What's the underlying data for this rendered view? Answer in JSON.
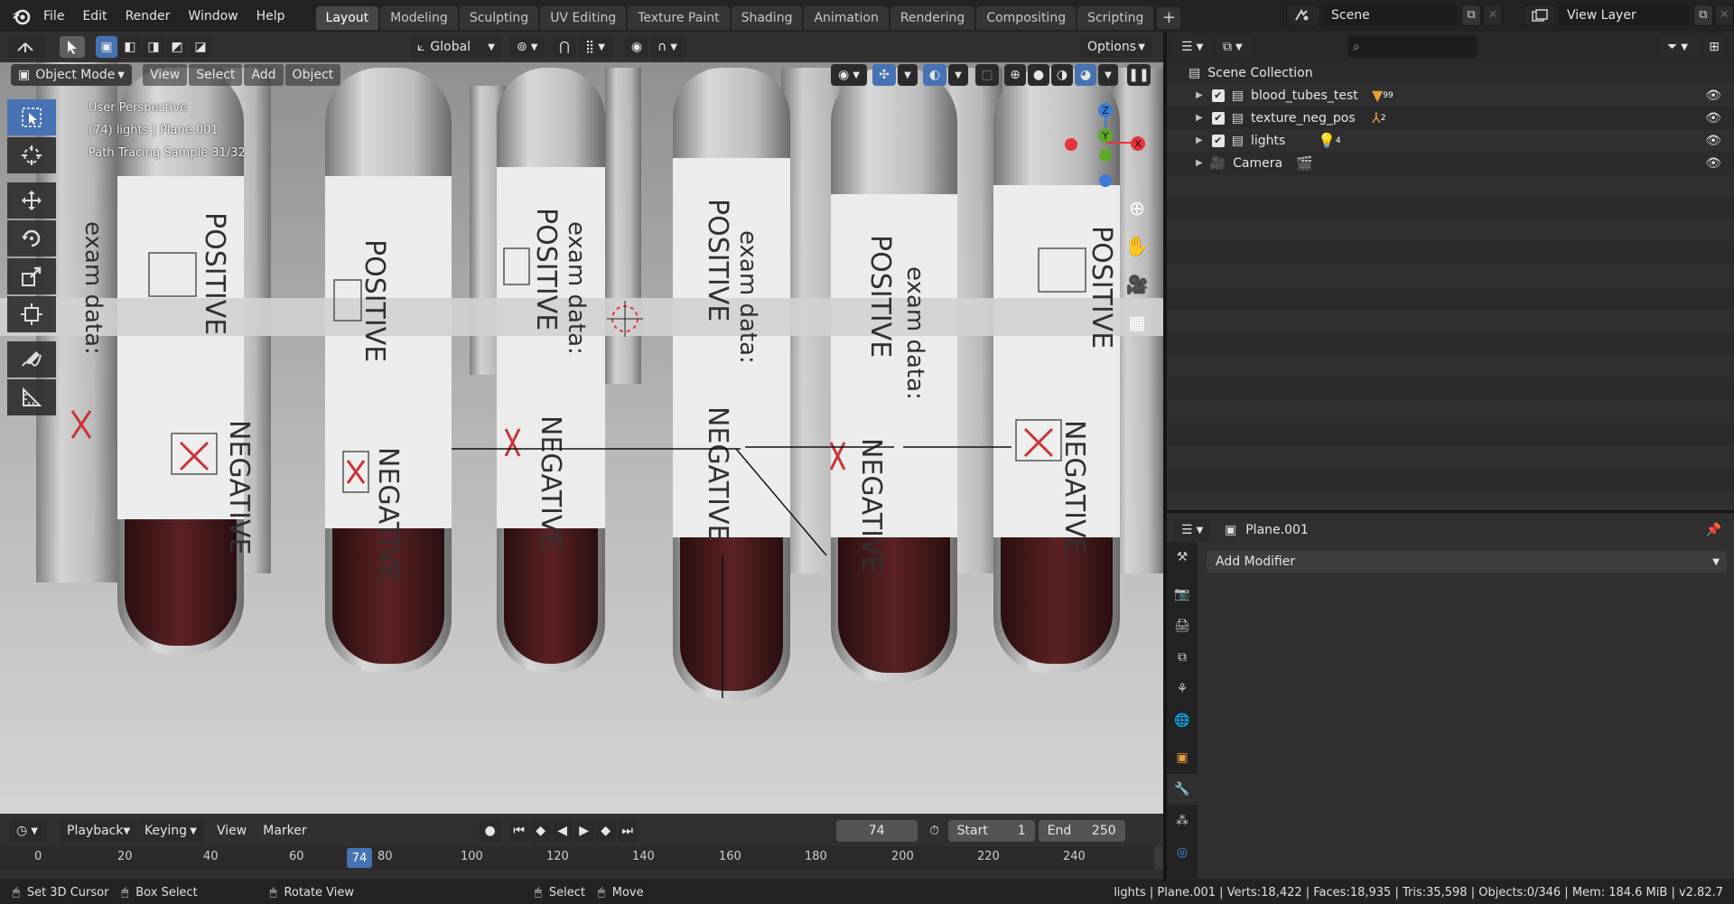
{
  "menu": {
    "items": [
      "File",
      "Edit",
      "Render",
      "Window",
      "Help"
    ]
  },
  "workspaces": [
    {
      "label": "Layout",
      "active": true
    },
    {
      "label": "Modeling",
      "active": false
    },
    {
      "label": "Sculpting",
      "active": false
    },
    {
      "label": "UV Editing",
      "active": false
    },
    {
      "label": "Texture Paint",
      "active": false
    },
    {
      "label": "Shading",
      "active": false
    },
    {
      "label": "Animation",
      "active": false
    },
    {
      "label": "Rendering",
      "active": false
    },
    {
      "label": "Compositing",
      "active": false
    },
    {
      "label": "Scripting",
      "active": false
    }
  ],
  "scene": {
    "name": "Scene"
  },
  "view_layer": {
    "name": "View Layer"
  },
  "viewport": {
    "orientation": "Global",
    "options_label": "Options",
    "mode": "Object Mode",
    "menus": [
      "View",
      "Select",
      "Add",
      "Object"
    ],
    "info": [
      "User Perspective",
      "(74) lights | Plane.001",
      "Path Tracing Sample 31/32"
    ],
    "gizmo_axes": {
      "z": "Z",
      "y": "Y",
      "x": "X"
    }
  },
  "render_scene": {
    "positive_label": "POSITIVE",
    "negative_label": "NEGATIVE",
    "exam_label": "exam data:"
  },
  "outliner": {
    "root": "Scene Collection",
    "items": [
      {
        "name": "blood_tubes_test",
        "badge": "99",
        "checked": true
      },
      {
        "name": "texture_neg_pos",
        "badge": "2",
        "checked": true
      },
      {
        "name": "lights",
        "badge": "4",
        "checked": true
      },
      {
        "name": "Camera",
        "badge": "",
        "checked": false
      }
    ]
  },
  "properties": {
    "object": "Plane.001",
    "add_modifier": "Add Modifier"
  },
  "timeline": {
    "playback": "Playback",
    "keying": "Keying",
    "view": "View",
    "marker": "Marker",
    "current_frame": "74",
    "start_label": "Start",
    "start": "1",
    "end_label": "End",
    "end": "250",
    "ticks": [
      "0",
      "20",
      "40",
      "60",
      "80",
      "100",
      "120",
      "140",
      "160",
      "180",
      "200",
      "220",
      "240"
    ]
  },
  "statusbar": {
    "set_cursor": "Set 3D Cursor",
    "box_select": "Box Select",
    "rotate_view": "Rotate View",
    "select": "Select",
    "move": "Move",
    "stats": "lights | Plane.001 | Verts:18,422 | Faces:18,935 | Tris:35,598 | Objects:0/346 | Mem: 184.6 MiB | v2.82.7"
  },
  "colors": {
    "accent": "#4772b3",
    "x_axis": "#e8323c",
    "y_axis": "#5ca928",
    "z_axis": "#3a7bd8"
  }
}
